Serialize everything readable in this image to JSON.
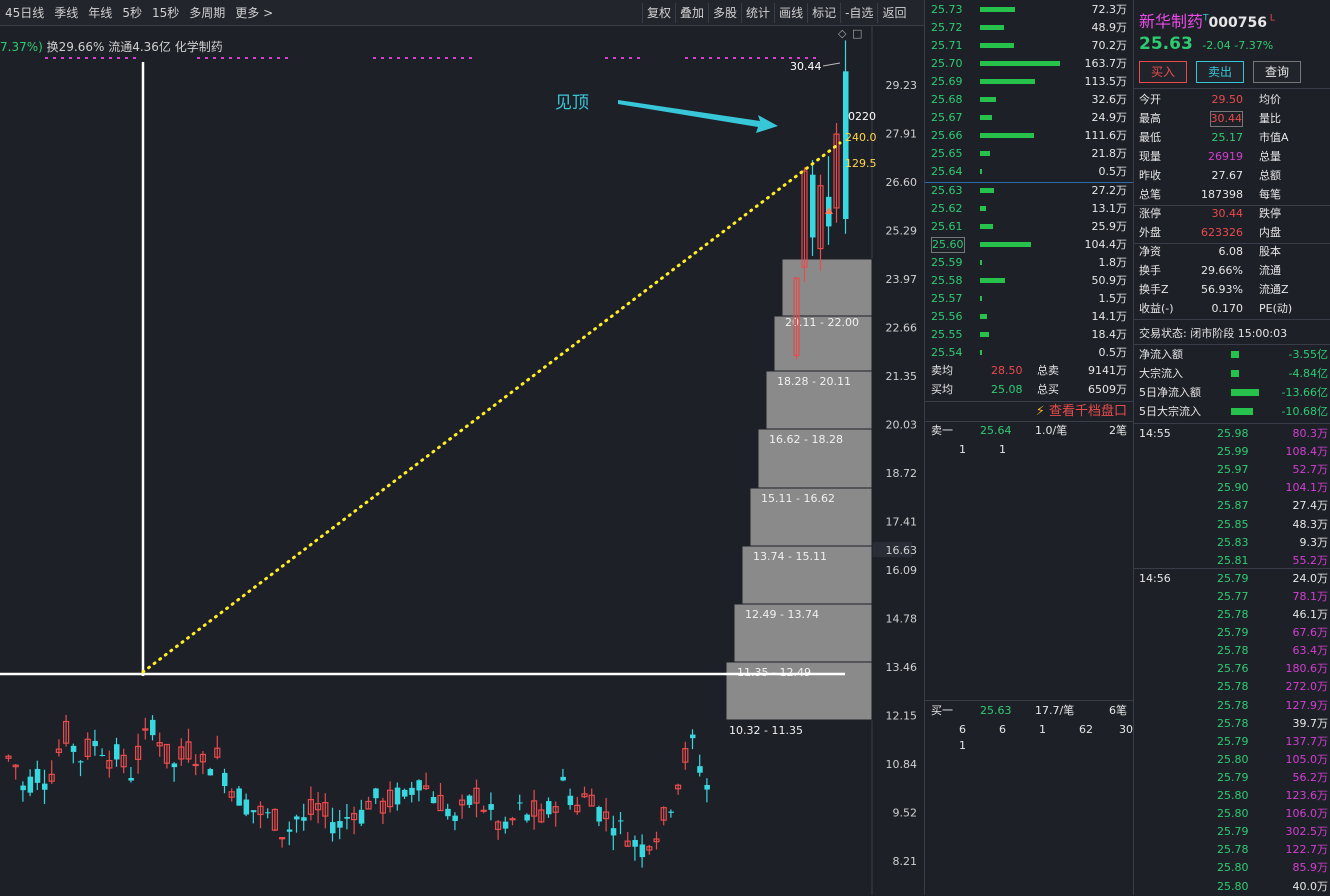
{
  "toolbar": {
    "periods": [
      "45日线",
      "季线",
      "年线",
      "5秒",
      "15秒",
      "多周期",
      "更多 >"
    ],
    "tools": [
      "复权",
      "叠加",
      "多股",
      "统计",
      "画线",
      "标记",
      "-自选",
      "返回"
    ]
  },
  "info": {
    "change_pct": "7.37%)",
    "text": "换29.66% 流通4.36亿 化学制药"
  },
  "chart": {
    "price_axis": [
      "29.23",
      "27.91",
      "26.60",
      "25.29",
      "23.97",
      "22.66",
      "21.35",
      "20.03",
      "18.72",
      "17.41",
      "16.63",
      "16.09",
      "14.78",
      "13.46",
      "12.15",
      "10.84",
      "9.52",
      "8.21"
    ],
    "current_price_label": "16.63",
    "high_label": "30.44",
    "annotation": "见顶",
    "side_labels": [
      "0220",
      "240.0",
      "129.5"
    ],
    "volume_profile": [
      "20.11 - 22.00",
      "18.28 - 20.11",
      "16.62 - 18.28",
      "15.11 - 16.62",
      "13.74 - 15.11",
      "12.49 - 13.74",
      "11.35 - 12.49",
      "10.32 - 11.35"
    ]
  },
  "order_book": {
    "sell": [
      {
        "price": "25.73",
        "vol": "72.3万",
        "ratio": 0.44
      },
      {
        "price": "25.72",
        "vol": "48.9万",
        "ratio": 0.3
      },
      {
        "price": "25.71",
        "vol": "70.2万",
        "ratio": 0.43
      },
      {
        "price": "25.70",
        "vol": "163.7万",
        "ratio": 1.0
      },
      {
        "price": "25.69",
        "vol": "113.5万",
        "ratio": 0.69
      },
      {
        "price": "25.68",
        "vol": "32.6万",
        "ratio": 0.2
      },
      {
        "price": "25.67",
        "vol": "24.9万",
        "ratio": 0.15
      },
      {
        "price": "25.66",
        "vol": "111.6万",
        "ratio": 0.68
      },
      {
        "price": "25.65",
        "vol": "21.8万",
        "ratio": 0.13
      },
      {
        "price": "25.64",
        "vol": "0.5万",
        "ratio": 0.02
      }
    ],
    "buy": [
      {
        "price": "25.63",
        "vol": "27.2万",
        "ratio": 0.17
      },
      {
        "price": "25.62",
        "vol": "13.1万",
        "ratio": 0.08
      },
      {
        "price": "25.61",
        "vol": "25.9万",
        "ratio": 0.16
      },
      {
        "price": "25.60",
        "vol": "104.4万",
        "ratio": 0.64
      },
      {
        "price": "25.59",
        "vol": "1.8万",
        "ratio": 0.02
      },
      {
        "price": "25.58",
        "vol": "50.9万",
        "ratio": 0.31
      },
      {
        "price": "25.57",
        "vol": "1.5万",
        "ratio": 0.02
      },
      {
        "price": "25.56",
        "vol": "14.1万",
        "ratio": 0.09
      },
      {
        "price": "25.55",
        "vol": "18.4万",
        "ratio": 0.11
      },
      {
        "price": "25.54",
        "vol": "0.5万",
        "ratio": 0.02
      }
    ],
    "summary": [
      {
        "l1": "卖均",
        "v1": "28.50",
        "l2": "总卖",
        "v2": "9141万"
      },
      {
        "l1": "买均",
        "v1": "25.08",
        "l2": "总买",
        "v2": "6509万"
      }
    ],
    "thousand_link": "查看千档盘口",
    "sell1": {
      "label": "卖一",
      "price": "25.64",
      "size": "1.0/笔",
      "count": "2笔",
      "queue": [
        "1",
        "1"
      ]
    },
    "buy1": {
      "label": "买一",
      "price": "25.63",
      "size": "17.7/笔",
      "count": "6笔",
      "queue": [
        "6",
        "6",
        "1",
        "62",
        "30"
      ],
      "queue2": [
        "1"
      ]
    }
  },
  "quote": {
    "name": "新华制药",
    "code": "000756",
    "price": "25.63",
    "change": "-2.04",
    "change_pct": "-7.37%",
    "buttons": [
      "买入",
      "卖出",
      "查询"
    ],
    "fields": [
      {
        "l": "今开",
        "v": "29.50",
        "c": "red",
        "l2": "均价"
      },
      {
        "l": "最高",
        "v": "30.44",
        "c": "red",
        "l2": "量比"
      },
      {
        "l": "最低",
        "v": "25.17",
        "c": "green",
        "l2": "市值A"
      },
      {
        "l": "现量",
        "v": "26919",
        "c": "mag",
        "l2": "总量"
      },
      {
        "l": "昨收",
        "v": "27.67",
        "c": "white",
        "l2": "总额"
      },
      {
        "l": "总笔",
        "v": "187398",
        "c": "white",
        "l2": "每笔"
      },
      {
        "l": "涨停",
        "v": "30.44",
        "c": "red",
        "l2": "跌停"
      },
      {
        "l": "外盘",
        "v": "623326",
        "c": "red",
        "l2": "内盘"
      },
      {
        "l": "净资",
        "v": "6.08",
        "c": "white",
        "l2": "股本"
      },
      {
        "l": "换手",
        "v": "29.66%",
        "c": "white",
        "l2": "流通"
      },
      {
        "l": "换手Z",
        "v": "56.93%",
        "c": "white",
        "l2": "流通Z"
      },
      {
        "l": "收益(-)",
        "v": "0.170",
        "c": "white",
        "l2": "PE(动)"
      }
    ],
    "trade_status": "交易状态: 闭市阶段 15:00:03",
    "flows": [
      {
        "l": "净流入额",
        "v": "-3.55亿",
        "w": 0.2
      },
      {
        "l": "大宗流入",
        "v": "-4.84亿",
        "w": 0.2
      },
      {
        "l": "5日净流入额",
        "v": "-13.66亿",
        "w": 0.7
      },
      {
        "l": "5日大宗流入",
        "v": "-10.68亿",
        "w": 0.55
      }
    ]
  },
  "ticks": [
    {
      "t": "14:55",
      "p": "25.98",
      "v": "80.3万",
      "c": "mag"
    },
    {
      "t": "",
      "p": "25.99",
      "v": "108.4万",
      "c": "mag"
    },
    {
      "t": "",
      "p": "25.97",
      "v": "52.7万",
      "c": "mag"
    },
    {
      "t": "",
      "p": "25.90",
      "v": "104.1万",
      "c": "mag"
    },
    {
      "t": "",
      "p": "25.87",
      "v": "27.4万",
      "c": "white"
    },
    {
      "t": "",
      "p": "25.85",
      "v": "48.3万",
      "c": "white"
    },
    {
      "t": "",
      "p": "25.83",
      "v": "9.3万",
      "c": "white"
    },
    {
      "t": "",
      "p": "25.81",
      "v": "55.2万",
      "c": "mag"
    },
    {
      "t": "14:56",
      "p": "25.79",
      "v": "24.0万",
      "c": "white"
    },
    {
      "t": "",
      "p": "25.77",
      "v": "78.1万",
      "c": "mag"
    },
    {
      "t": "",
      "p": "25.78",
      "v": "46.1万",
      "c": "white"
    },
    {
      "t": "",
      "p": "25.79",
      "v": "67.6万",
      "c": "mag"
    },
    {
      "t": "",
      "p": "25.78",
      "v": "63.4万",
      "c": "mag"
    },
    {
      "t": "",
      "p": "25.76",
      "v": "180.6万",
      "c": "mag"
    },
    {
      "t": "",
      "p": "25.78",
      "v": "272.0万",
      "c": "mag"
    },
    {
      "t": "",
      "p": "25.78",
      "v": "127.9万",
      "c": "mag"
    },
    {
      "t": "",
      "p": "25.78",
      "v": "39.7万",
      "c": "white"
    },
    {
      "t": "",
      "p": "25.79",
      "v": "137.7万",
      "c": "mag"
    },
    {
      "t": "",
      "p": "25.80",
      "v": "105.0万",
      "c": "mag"
    },
    {
      "t": "",
      "p": "25.79",
      "v": "56.2万",
      "c": "mag"
    },
    {
      "t": "",
      "p": "25.80",
      "v": "123.6万",
      "c": "mag"
    },
    {
      "t": "",
      "p": "25.80",
      "v": "106.0万",
      "c": "mag"
    },
    {
      "t": "",
      "p": "25.79",
      "v": "302.5万",
      "c": "mag"
    },
    {
      "t": "",
      "p": "25.78",
      "v": "122.7万",
      "c": "mag"
    },
    {
      "t": "",
      "p": "25.80",
      "v": "85.9万",
      "c": "mag"
    },
    {
      "t": "",
      "p": "25.80",
      "v": "40.0万",
      "c": "white"
    }
  ],
  "colors": {
    "up": "#e84b4b",
    "down": "#38d8e0",
    "profile": "#8a8a8a",
    "trend": "#ffee22"
  }
}
